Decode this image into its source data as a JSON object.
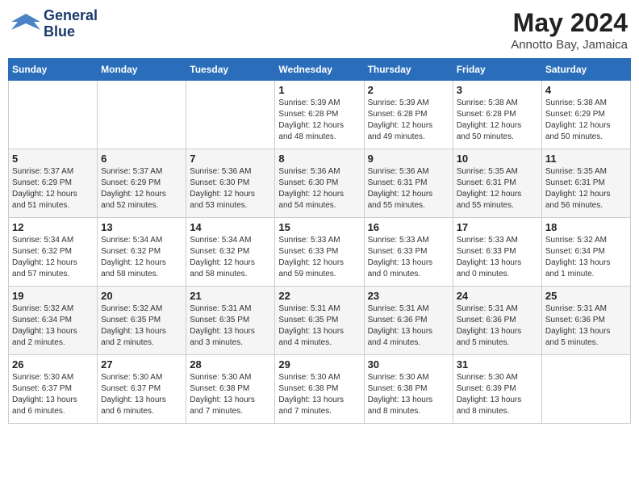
{
  "header": {
    "logo_line1": "General",
    "logo_line2": "Blue",
    "month_year": "May 2024",
    "location": "Annotto Bay, Jamaica"
  },
  "days_of_week": [
    "Sunday",
    "Monday",
    "Tuesday",
    "Wednesday",
    "Thursday",
    "Friday",
    "Saturday"
  ],
  "weeks": [
    [
      {
        "num": "",
        "info": ""
      },
      {
        "num": "",
        "info": ""
      },
      {
        "num": "",
        "info": ""
      },
      {
        "num": "1",
        "info": "Sunrise: 5:39 AM\nSunset: 6:28 PM\nDaylight: 12 hours\nand 48 minutes."
      },
      {
        "num": "2",
        "info": "Sunrise: 5:39 AM\nSunset: 6:28 PM\nDaylight: 12 hours\nand 49 minutes."
      },
      {
        "num": "3",
        "info": "Sunrise: 5:38 AM\nSunset: 6:28 PM\nDaylight: 12 hours\nand 50 minutes."
      },
      {
        "num": "4",
        "info": "Sunrise: 5:38 AM\nSunset: 6:29 PM\nDaylight: 12 hours\nand 50 minutes."
      }
    ],
    [
      {
        "num": "5",
        "info": "Sunrise: 5:37 AM\nSunset: 6:29 PM\nDaylight: 12 hours\nand 51 minutes."
      },
      {
        "num": "6",
        "info": "Sunrise: 5:37 AM\nSunset: 6:29 PM\nDaylight: 12 hours\nand 52 minutes."
      },
      {
        "num": "7",
        "info": "Sunrise: 5:36 AM\nSunset: 6:30 PM\nDaylight: 12 hours\nand 53 minutes."
      },
      {
        "num": "8",
        "info": "Sunrise: 5:36 AM\nSunset: 6:30 PM\nDaylight: 12 hours\nand 54 minutes."
      },
      {
        "num": "9",
        "info": "Sunrise: 5:36 AM\nSunset: 6:31 PM\nDaylight: 12 hours\nand 55 minutes."
      },
      {
        "num": "10",
        "info": "Sunrise: 5:35 AM\nSunset: 6:31 PM\nDaylight: 12 hours\nand 55 minutes."
      },
      {
        "num": "11",
        "info": "Sunrise: 5:35 AM\nSunset: 6:31 PM\nDaylight: 12 hours\nand 56 minutes."
      }
    ],
    [
      {
        "num": "12",
        "info": "Sunrise: 5:34 AM\nSunset: 6:32 PM\nDaylight: 12 hours\nand 57 minutes."
      },
      {
        "num": "13",
        "info": "Sunrise: 5:34 AM\nSunset: 6:32 PM\nDaylight: 12 hours\nand 58 minutes."
      },
      {
        "num": "14",
        "info": "Sunrise: 5:34 AM\nSunset: 6:32 PM\nDaylight: 12 hours\nand 58 minutes."
      },
      {
        "num": "15",
        "info": "Sunrise: 5:33 AM\nSunset: 6:33 PM\nDaylight: 12 hours\nand 59 minutes."
      },
      {
        "num": "16",
        "info": "Sunrise: 5:33 AM\nSunset: 6:33 PM\nDaylight: 13 hours\nand 0 minutes."
      },
      {
        "num": "17",
        "info": "Sunrise: 5:33 AM\nSunset: 6:33 PM\nDaylight: 13 hours\nand 0 minutes."
      },
      {
        "num": "18",
        "info": "Sunrise: 5:32 AM\nSunset: 6:34 PM\nDaylight: 13 hours\nand 1 minute."
      }
    ],
    [
      {
        "num": "19",
        "info": "Sunrise: 5:32 AM\nSunset: 6:34 PM\nDaylight: 13 hours\nand 2 minutes."
      },
      {
        "num": "20",
        "info": "Sunrise: 5:32 AM\nSunset: 6:35 PM\nDaylight: 13 hours\nand 2 minutes."
      },
      {
        "num": "21",
        "info": "Sunrise: 5:31 AM\nSunset: 6:35 PM\nDaylight: 13 hours\nand 3 minutes."
      },
      {
        "num": "22",
        "info": "Sunrise: 5:31 AM\nSunset: 6:35 PM\nDaylight: 13 hours\nand 4 minutes."
      },
      {
        "num": "23",
        "info": "Sunrise: 5:31 AM\nSunset: 6:36 PM\nDaylight: 13 hours\nand 4 minutes."
      },
      {
        "num": "24",
        "info": "Sunrise: 5:31 AM\nSunset: 6:36 PM\nDaylight: 13 hours\nand 5 minutes."
      },
      {
        "num": "25",
        "info": "Sunrise: 5:31 AM\nSunset: 6:36 PM\nDaylight: 13 hours\nand 5 minutes."
      }
    ],
    [
      {
        "num": "26",
        "info": "Sunrise: 5:30 AM\nSunset: 6:37 PM\nDaylight: 13 hours\nand 6 minutes."
      },
      {
        "num": "27",
        "info": "Sunrise: 5:30 AM\nSunset: 6:37 PM\nDaylight: 13 hours\nand 6 minutes."
      },
      {
        "num": "28",
        "info": "Sunrise: 5:30 AM\nSunset: 6:38 PM\nDaylight: 13 hours\nand 7 minutes."
      },
      {
        "num": "29",
        "info": "Sunrise: 5:30 AM\nSunset: 6:38 PM\nDaylight: 13 hours\nand 7 minutes."
      },
      {
        "num": "30",
        "info": "Sunrise: 5:30 AM\nSunset: 6:38 PM\nDaylight: 13 hours\nand 8 minutes."
      },
      {
        "num": "31",
        "info": "Sunrise: 5:30 AM\nSunset: 6:39 PM\nDaylight: 13 hours\nand 8 minutes."
      },
      {
        "num": "",
        "info": ""
      }
    ]
  ]
}
